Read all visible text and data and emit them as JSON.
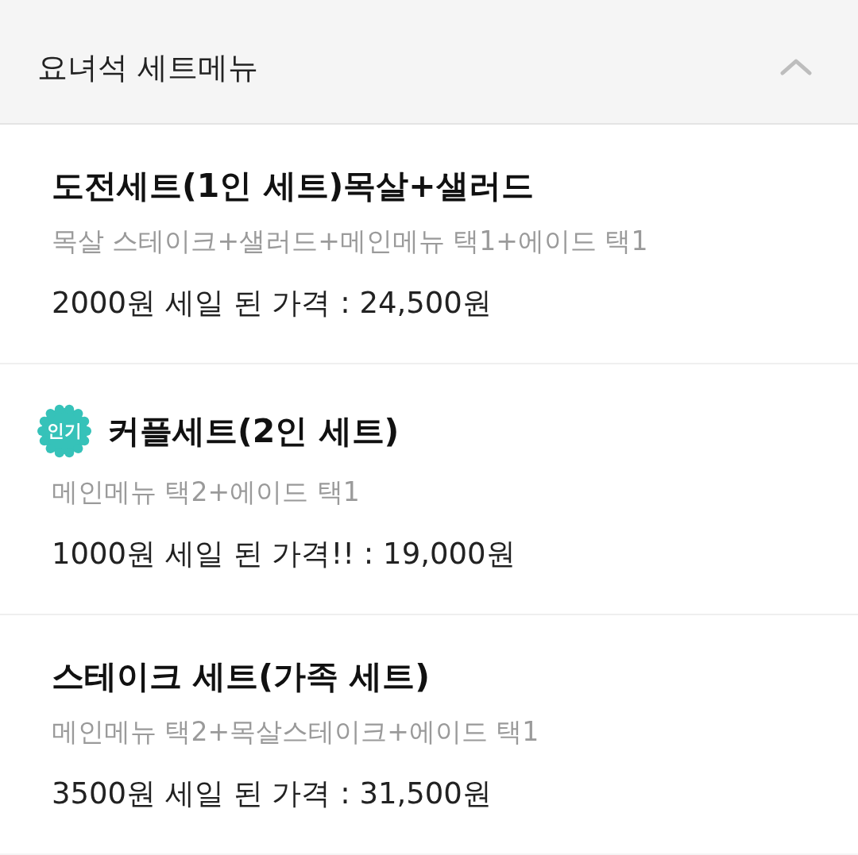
{
  "section": {
    "title": "요녀석 세트메뉴",
    "expanded": true
  },
  "items": [
    {
      "name": "도전세트(1인 세트)목살+샐러드",
      "description": "목살 스테이크+샐러드+메인메뉴 택1+에이드 택1",
      "price": "2000원 세일 된 가격 : 24,500원"
    },
    {
      "badge": "인기",
      "name": "커플세트(2인 세트)",
      "description": "메인메뉴 택2+에이드 택1",
      "price": "1000원 세일 된 가격!! : 19,000원"
    },
    {
      "name": "스테이크 세트(가족 세트)",
      "description": "메인메뉴 택2+목살스테이크+에이드 택1",
      "price": "3500원 세일 된 가격 : 31,500원"
    }
  ]
}
